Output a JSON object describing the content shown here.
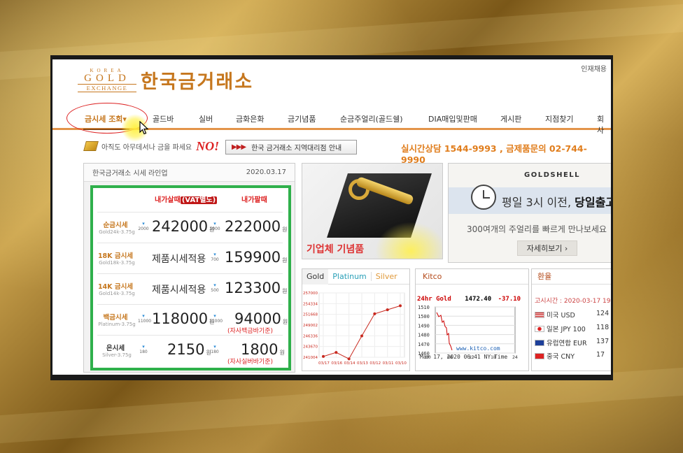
{
  "header": {
    "top_link": "인재채용",
    "logo_small": "KOREA",
    "logo_gold": "GOLD",
    "logo_exchange": "EXCHANGE",
    "logo_text": "한국금거래소"
  },
  "nav": [
    {
      "label": "금시세 조회▾",
      "active": true
    },
    {
      "label": "골드바"
    },
    {
      "label": "실버"
    },
    {
      "label": "금화은화"
    },
    {
      "label": "금기념품"
    },
    {
      "label": "순금주얼리(골드쉘)"
    },
    {
      "label": "DIA매입및판매"
    },
    {
      "label": "게시판"
    },
    {
      "label": "지점찾기"
    },
    {
      "label": "회사"
    }
  ],
  "promo": {
    "text": "아직도 아무데서나 금을 파세요",
    "no": "NO!",
    "agent_button": "한국 금거래소 지역대리점 안내",
    "phone": "실시간상담 1544-9993 , 금제품문의 02-744-9990"
  },
  "prices": {
    "title": "한국금거래소 시세 라인업",
    "date": "2020.03.17",
    "col_buy": "내가살때",
    "col_buy_vat": "(VAT별도)",
    "col_sell": "내가팔때",
    "won": "원",
    "rows": [
      {
        "name": "순금시세",
        "sub": "Gold24k-3.75g",
        "buy_chg": "2000",
        "buy": "242000",
        "sell_chg": "1000",
        "sell": "222000"
      },
      {
        "name": "18K 금시세",
        "sub": "Gold18k-3.75g",
        "buy_text": "제품시세적용",
        "sell_chg": "700",
        "sell": "159900"
      },
      {
        "name": "14K 금시세",
        "sub": "Gold14k-3.75g",
        "buy_text": "제품시세적용",
        "sell_chg": "500",
        "sell": "123300"
      },
      {
        "name": "백금시세",
        "sub": "Platinum-3.75g",
        "buy_chg": "11000",
        "buy": "118000",
        "sell_chg": "11000",
        "sell": "94000",
        "note": "(자사백금바기준)"
      },
      {
        "name": "은시세",
        "sub": "Silver-3.75g",
        "buy_chg": "180",
        "buy": "2150",
        "sell_chg": "180",
        "sell": "1800",
        "note": "(자사실버바기준)"
      }
    ]
  },
  "banner": {
    "caption": "기업체 기념품"
  },
  "goldshell": {
    "logo": "GOLDSHELL",
    "line1_a": "평일 3시 이전, ",
    "line1_b": "당일출고",
    "line2": "300여개의 주얼리를 빠르게 만나보세요",
    "button": "자세히보기 ›"
  },
  "chart_tabs": [
    "Gold",
    "Platinum",
    "Silver"
  ],
  "chart_data": {
    "type": "line",
    "x": [
      "03/17",
      "03/16",
      "03/14",
      "03/13",
      "03/12",
      "03/11",
      "03/10"
    ],
    "values": [
      241200,
      242200,
      240600,
      246300,
      251800,
      252800,
      253800
    ],
    "y_ticks": [
      "257000",
      "254334",
      "251668",
      "249002",
      "246336",
      "243670",
      "241004"
    ],
    "ylim": [
      241004,
      257000
    ],
    "color": "#c8281e"
  },
  "kitco": {
    "title": "Kitco",
    "label": "24hr Gold",
    "price": "1472.40",
    "change": "-37.10",
    "y_ticks": [
      "1510",
      "1500",
      "1490",
      "1480",
      "1470",
      "1460"
    ],
    "x_ticks": [
      "00",
      "06",
      "12",
      "18",
      "24"
    ],
    "url": "www.kitco.com",
    "footer": "Mar 17, 2020 06:41 NY Time"
  },
  "fx": {
    "title": "환율",
    "time": "고시시간 : 2020-03-17 19",
    "rows": [
      {
        "country": "미국",
        "code": "USD",
        "value": "124"
      },
      {
        "country": "일본",
        "code": "JPY 100",
        "value": "118"
      },
      {
        "country": "유럽연합",
        "code": "EUR",
        "value": "137"
      },
      {
        "country": "중국",
        "code": "CNY",
        "value": "17"
      }
    ]
  }
}
